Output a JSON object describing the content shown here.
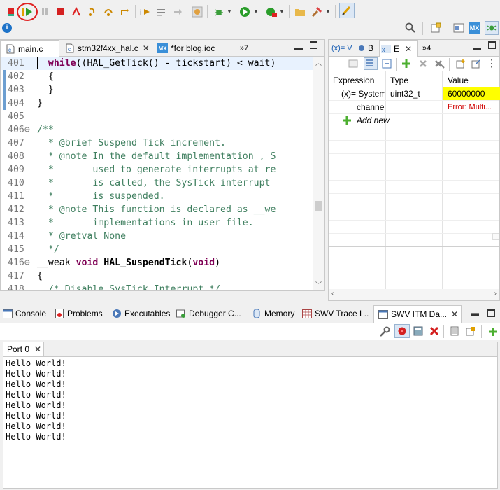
{
  "toolbar1": {
    "icons": [
      "skip-breakpoints-icon",
      "resume-icon",
      "suspend-icon",
      "terminate-icon",
      "disconnect-icon",
      "step-into-icon",
      "step-over-icon",
      "step-return-icon",
      "instruction-stepping-icon",
      "use-step-filters-icon",
      "restart-icon",
      "debug-settings-icon",
      "debug-run-icon",
      "run-icon",
      "external-tools-icon",
      "open-folder-icon",
      "build-icon",
      "highlight-icon"
    ]
  },
  "editor": {
    "tabs": [
      {
        "label": "main.c",
        "icon": "c-file-icon"
      },
      {
        "label": "stm32f4xx_hal.c",
        "icon": "c-file-icon"
      },
      {
        "label": "*for blog.ioc",
        "icon": "mx-icon"
      },
      {
        "label": "»7",
        "icon": "overflow-icon"
      }
    ],
    "lines": [
      {
        "num": "401",
        "html": "  <span class=\"kw\">while</span>((HAL_GetTick() - tickstart) &lt; wait)"
      },
      {
        "num": "402",
        "html": "  {"
      },
      {
        "num": "403",
        "html": "  }"
      },
      {
        "num": "404",
        "html": "}"
      },
      {
        "num": "405",
        "html": ""
      },
      {
        "num": "406⊖",
        "html": "<span class=\"cm\">/**</span>"
      },
      {
        "num": "407",
        "html": "<span class=\"cm\">  * @brief Suspend Tick increment.</span>"
      },
      {
        "num": "408",
        "html": "<span class=\"cm\">  * @note In the default implementation , S</span>"
      },
      {
        "num": "409",
        "html": "<span class=\"cm\">  *       used to generate interrupts at re</span>"
      },
      {
        "num": "410",
        "html": "<span class=\"cm\">  *       is called, the SysTick interrupt</span>"
      },
      {
        "num": "411",
        "html": "<span class=\"cm\">  *       is suspended.</span>"
      },
      {
        "num": "412",
        "html": "<span class=\"cm\">  * @note This function is declared as __we</span>"
      },
      {
        "num": "413",
        "html": "<span class=\"cm\">  *       implementations in user file.</span>"
      },
      {
        "num": "414",
        "html": "<span class=\"cm\">  * @retval None</span>"
      },
      {
        "num": "415",
        "html": "<span class=\"cm\">  */</span>"
      },
      {
        "num": "416⊖",
        "html": "__weak <span class=\"kw\">void</span> <span class=\"fn\">HAL_SuspendTick</span>(<span class=\"kw\">void</span>)"
      },
      {
        "num": "417",
        "html": "{"
      },
      {
        "num": "418",
        "html": "  <span class=\"cm\">/* Disable SysTick Interrupt */</span>"
      }
    ]
  },
  "expressions": {
    "tabs": [
      {
        "label": "(x)= V"
      },
      {
        "label": "B"
      },
      {
        "label": "E"
      },
      {
        "label": "»4"
      }
    ],
    "headers": {
      "expression": "Expression",
      "type": "Type",
      "value": "Value"
    },
    "rows": [
      {
        "expression": "(x)= SystemC",
        "type": "uint32_t",
        "value": "60000000"
      },
      {
        "expression": "channel",
        "type": "",
        "value": "Error: Multi..."
      },
      {
        "expression": "Add new",
        "type": "",
        "value": ""
      }
    ]
  },
  "bottom": {
    "tabs": [
      {
        "label": "Console",
        "icon": "console-icon"
      },
      {
        "label": "Problems",
        "icon": "problems-icon"
      },
      {
        "label": "Executables",
        "icon": "executables-icon"
      },
      {
        "label": "Debugger C...",
        "icon": "debugger-console-icon"
      },
      {
        "label": "Memory",
        "icon": "memory-icon"
      },
      {
        "label": "SWV Trace L...",
        "icon": "swv-trace-icon"
      },
      {
        "label": "SWV ITM Da...",
        "icon": "swv-itm-icon"
      }
    ],
    "port_tab": "Port 0",
    "output": [
      "Hello World!",
      "Hello World!",
      "Hello World!",
      "Hello World!",
      "Hello World!",
      "Hello World!",
      "Hello World!",
      "Hello World!"
    ]
  },
  "colors": {
    "value_highlight": "#ffff00",
    "error_text": "#d00000",
    "current_line": "#e8f2fe",
    "resume_circle": "#e02020"
  }
}
